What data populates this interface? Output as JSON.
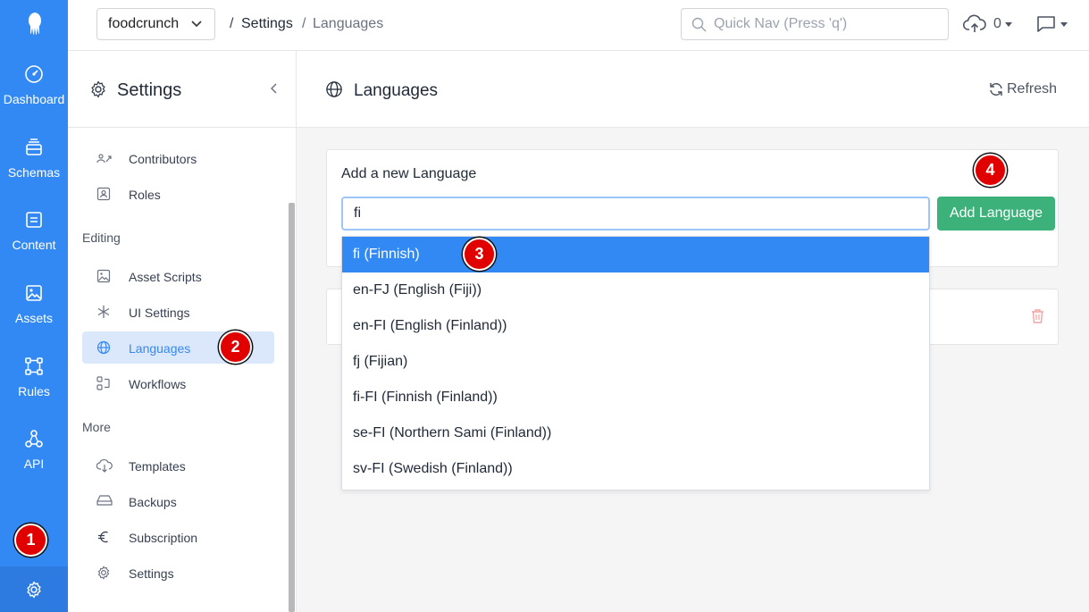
{
  "app": {
    "name": "foodcrunch"
  },
  "breadcrumb": {
    "sep1": "/",
    "item1": "Settings",
    "sep2": "/",
    "item2": "Languages"
  },
  "search": {
    "placeholder": "Quick Nav (Press 'q')"
  },
  "uploads": {
    "count": "0"
  },
  "rail": {
    "items": [
      {
        "label": "Dashboard",
        "icon": "gauge-icon"
      },
      {
        "label": "Schemas",
        "icon": "schemas-icon"
      },
      {
        "label": "Content",
        "icon": "content-icon"
      },
      {
        "label": "Assets",
        "icon": "assets-icon"
      },
      {
        "label": "Rules",
        "icon": "rules-icon"
      },
      {
        "label": "API",
        "icon": "api-icon"
      }
    ]
  },
  "settings_panel": {
    "title": "Settings",
    "sections": {
      "editing": "Editing",
      "more": "More"
    },
    "items": [
      {
        "label": "Contributors",
        "icon": "contributors-icon"
      },
      {
        "label": "Roles",
        "icon": "roles-icon"
      },
      {
        "label": "Asset Scripts",
        "icon": "asset-scripts-icon"
      },
      {
        "label": "UI Settings",
        "icon": "asterisk-icon"
      },
      {
        "label": "Languages",
        "icon": "globe-icon",
        "active": true
      },
      {
        "label": "Workflows",
        "icon": "workflows-icon"
      },
      {
        "label": "Templates",
        "icon": "cloud-download-icon"
      },
      {
        "label": "Backups",
        "icon": "drive-icon"
      },
      {
        "label": "Subscription",
        "icon": "euro-icon"
      },
      {
        "label": "Settings",
        "icon": "gear-icon"
      }
    ]
  },
  "main": {
    "title": "Languages",
    "refresh_label": "Refresh",
    "add_card": {
      "heading": "Add a new Language",
      "input_value": "fi",
      "button_label": "Add Language"
    }
  },
  "dropdown": {
    "options": [
      "fi (Finnish)",
      "en-FJ (English (Fiji))",
      "en-FI (English (Finland))",
      "fj (Fijian)",
      "fi-FI (Finnish (Finland))",
      "se-FI (Northern Sami (Finland))",
      "sv-FI (Swedish (Finland))"
    ],
    "selected": "fi (Finnish)"
  },
  "annotations": [
    "1",
    "2",
    "3",
    "4"
  ],
  "colors": {
    "accent": "#3389f4",
    "success": "#3cb179",
    "badge": "#e00000",
    "danger": "#f3a3a3"
  }
}
